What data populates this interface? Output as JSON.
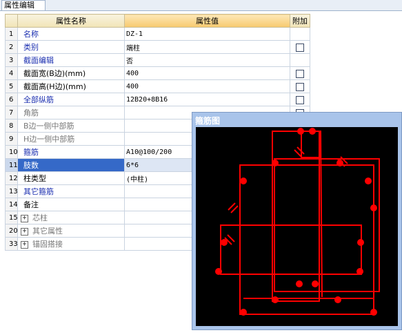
{
  "tab": {
    "label": "属性编辑"
  },
  "columns": {
    "name": "属性名称",
    "value": "属性值",
    "extra": "附加"
  },
  "rows": [
    {
      "num": "1",
      "name": "名称",
      "value": "DZ-1"
    },
    {
      "num": "2",
      "name": "类别",
      "value": "端柱"
    },
    {
      "num": "3",
      "name": "截面编辑",
      "value": "否"
    },
    {
      "num": "4",
      "name": "截面宽(B边)(mm)",
      "value": "400"
    },
    {
      "num": "5",
      "name": "截面高(H边)(mm)",
      "value": "400"
    },
    {
      "num": "6",
      "name": "全部纵筋",
      "value": "12B20+8B16"
    },
    {
      "num": "7",
      "name": "角筋",
      "value": ""
    },
    {
      "num": "8",
      "name": "B边一侧中部筋",
      "value": ""
    },
    {
      "num": "9",
      "name": "H边一侧中部筋",
      "value": ""
    },
    {
      "num": "10",
      "name": "箍筋",
      "value": "A10@100/200"
    },
    {
      "num": "11",
      "name": "肢数",
      "value": "6*6"
    },
    {
      "num": "12",
      "name": "柱类型",
      "value": "(中柱)"
    },
    {
      "num": "13",
      "name": "其它箍筋",
      "value": ""
    },
    {
      "num": "14",
      "name": "备注",
      "value": ""
    },
    {
      "num": "15",
      "name": "芯柱",
      "value": ""
    },
    {
      "num": "20",
      "name": "其它属性",
      "value": ""
    },
    {
      "num": "33",
      "name": "锚固搭接",
      "value": ""
    }
  ],
  "expander_symbol": "+",
  "popup": {
    "title": "箍筋图"
  },
  "colors": {
    "rebar": "#ff0000",
    "selected_row": "#3569c8",
    "header_value": "#f7c96d"
  }
}
